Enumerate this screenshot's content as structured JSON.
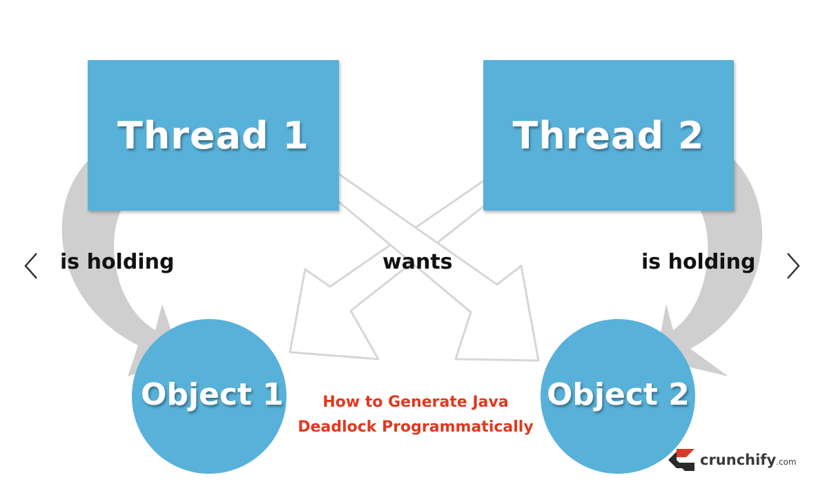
{
  "diagram": {
    "thread1": "Thread 1",
    "thread2": "Thread 2",
    "object1": "Object 1",
    "object2": "Object 2",
    "holding_left": "is holding",
    "holding_right": "is holding",
    "wants": "wants"
  },
  "caption": {
    "line1": "How to Generate Java",
    "line2": "Deadlock Programmatically"
  },
  "brand": {
    "name": "crunchify",
    "suffix": ".com"
  },
  "navigation": {
    "prev_icon": "chevron-left-icon",
    "next_icon": "chevron-right-icon"
  },
  "colors": {
    "box": "#58b1d9",
    "caption": "#e0391f",
    "arrow_gray": "#cfcfcf"
  }
}
